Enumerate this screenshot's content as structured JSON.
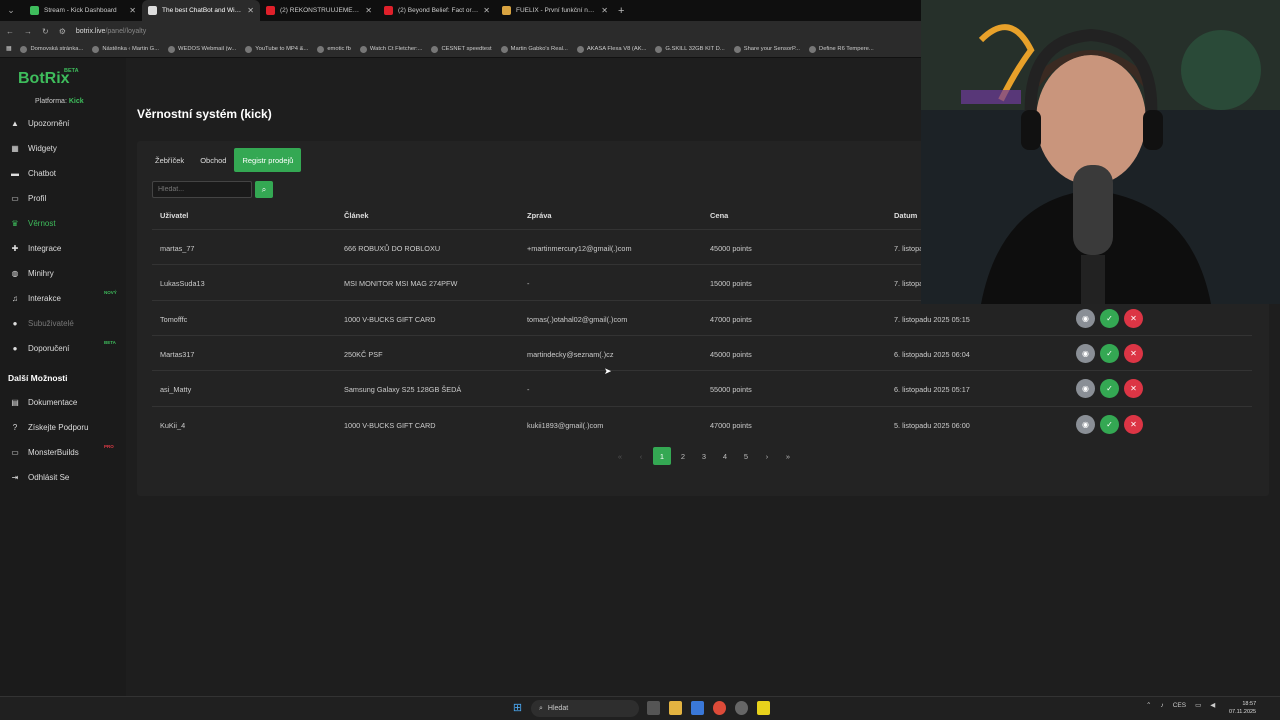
{
  "browser": {
    "tabs": [
      {
        "title": "Stream - Kick Dashboard",
        "color": "#3ebd5c"
      },
      {
        "title": "The best ChatBot and Widgets",
        "color": "#dddddd"
      },
      {
        "title": "(2) REKONSTRUUJEME BYT, KD",
        "color": "#e0202a"
      },
      {
        "title": "(2) Beyond Belief: Fact or Fiction",
        "color": "#e0202a"
      },
      {
        "title": "FUELIX - První funkční nápoj pro",
        "color": "#d9a441"
      }
    ],
    "url": "botrix.live",
    "url_path": "/panel/loyalty",
    "bookmarks": [
      "Domovská stránka...",
      "Nástěnka ‹ Martin G...",
      "WEDOS Webmail (w...",
      "YouTube to MP4 &...",
      "emotic fb",
      "Watch Ct Fletcher:...",
      "CESNET speedtest",
      "Martin Gabko's Real...",
      "AKASA Flexa V8 (AK...",
      "G.SKILL 32GB KIT D...",
      "Share your SensorP...",
      "Define R6 Tempere..."
    ]
  },
  "sidebar": {
    "logo": "BotRix",
    "logo_badge": "BETA",
    "platform_label": "Platforma:",
    "platform_value": "Kick",
    "items": [
      {
        "label": "Upozornění",
        "icon": "warning-icon",
        "glyph": "▲"
      },
      {
        "label": "Widgety",
        "icon": "widgets-icon",
        "glyph": "▦"
      },
      {
        "label": "Chatbot",
        "icon": "chat-icon",
        "glyph": "▬"
      },
      {
        "label": "Profil",
        "icon": "profile-icon",
        "glyph": "▭"
      },
      {
        "label": "Věrnost",
        "icon": "trophy-icon",
        "glyph": "♛"
      },
      {
        "label": "Integrace",
        "icon": "puzzle-icon",
        "glyph": "✚"
      },
      {
        "label": "Minihry",
        "icon": "gamepad-icon",
        "glyph": "◍"
      },
      {
        "label": "Interakce",
        "icon": "music-icon",
        "glyph": "♫",
        "badge": "NOVÝ"
      },
      {
        "label": "Subuživatelé",
        "icon": "users-icon",
        "glyph": "●"
      },
      {
        "label": "Doporučení",
        "icon": "referral-icon",
        "glyph": "●",
        "badge": "BETA"
      }
    ],
    "section_header": "Další Možnosti",
    "more_items": [
      {
        "label": "Dokumentace",
        "icon": "docs-icon",
        "glyph": "▤"
      },
      {
        "label": "Získejte Podporu",
        "icon": "help-icon",
        "glyph": "?"
      },
      {
        "label": "MonsterBuilds",
        "icon": "monitor-icon",
        "glyph": "▭",
        "badge": "PRO"
      },
      {
        "label": "Odhlásit Se",
        "icon": "logout-icon",
        "glyph": "⇥"
      }
    ]
  },
  "page": {
    "title": "Věrnostní systém (kick)",
    "tabs": [
      "Žebříček",
      "Obchod",
      "Registr prodejů"
    ],
    "search_placeholder": "Hledat...",
    "columns": [
      "Uživatel",
      "Článek",
      "Zpráva",
      "Cena",
      "Datum"
    ],
    "rows": [
      {
        "user": "martas_77",
        "item": "666 ROBUXŮ DO ROBLOXU",
        "message": "+martinmercury12@gmail(.)com",
        "price": "45000 points",
        "date": "7. listopadu 2025 05:30"
      },
      {
        "user": "LukasSuda13",
        "item": "MSI MONITOR MSI MAG 274PFW",
        "message": "-",
        "price": "15000 points",
        "date": "7. listopadu 2025 05:22"
      },
      {
        "user": "Tomofffc",
        "item": "1000 V-BUCKS GIFT CARD",
        "message": "tomas(.)otahal02@gmail(.)com",
        "price": "47000 points",
        "date": "7. listopadu 2025 05:15"
      },
      {
        "user": "Martas317",
        "item": "250KČ PSF",
        "message": "martindecky@seznam(.)cz",
        "price": "45000 points",
        "date": "6. listopadu 2025 06:04"
      },
      {
        "user": "asi_Matty",
        "item": "Samsung Galaxy S25 128GB ŠEDÁ",
        "message": "-",
        "price": "55000 points",
        "date": "6. listopadu 2025 05:17"
      },
      {
        "user": "KuKii_4",
        "item": "1000 V-BUCKS GIFT CARD",
        "message": "kukii1893@gmail(.)com",
        "price": "47000 points",
        "date": "5. listopadu 2025 06:00"
      }
    ],
    "pagination": {
      "pages": [
        "1",
        "2",
        "3",
        "4",
        "5"
      ],
      "current": "1"
    }
  },
  "taskbar": {
    "search_label": "Hledat",
    "language": "CES",
    "time": "18:57",
    "date": "07.11.2025"
  }
}
